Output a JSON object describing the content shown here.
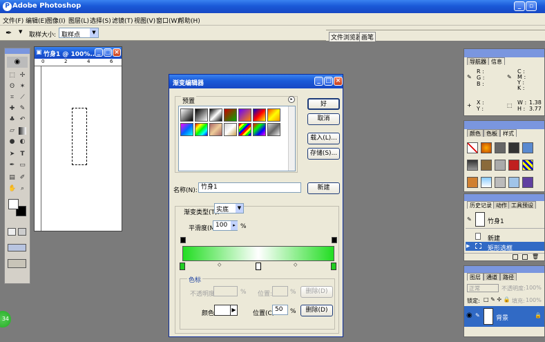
{
  "app": {
    "title": "Adobe Photoshop",
    "icon": "photoshop-icon"
  },
  "menu": [
    "文件(F)",
    "编辑(E)",
    "图像(I)",
    "图层(L)",
    "选择(S)",
    "滤镜(T)",
    "视图(V)",
    "窗口(W)",
    "帮助(H)"
  ],
  "options": {
    "sample_label": "取样大小:",
    "sample_value": "取样点",
    "tabs": [
      "文件浏览器",
      "画笔"
    ]
  },
  "doc": {
    "title": "竹身1 @ 100%...",
    "ruler": [
      "0",
      "2",
      "4",
      "6"
    ]
  },
  "dialog": {
    "title": "渐变编辑器",
    "presets_label": "预置",
    "ok": "好",
    "cancel": "取消",
    "load": "载入(L)...",
    "save": "存储(S)...",
    "name_label": "名称(N):",
    "name_value": "竹身1",
    "new_btn": "新建",
    "type_label": "渐变类型(T):",
    "type_value": "实底",
    "smooth_label": "平滑度(M):",
    "smooth_value": "100",
    "smooth_unit": "%",
    "stops": {
      "title": "色标",
      "opacity_label": "不透明度:",
      "opacity_unit": "%",
      "loc_label": "位置:",
      "loc_unit": "%",
      "delete_label": "删除(D)",
      "color_label": "颜色:",
      "color_loc_label": "位置(C):",
      "color_loc_value": "50",
      "color_loc_unit": "%",
      "color_delete": "删除(D)"
    },
    "gradient": {
      "left": "#22dd22",
      "mid": "#ffffff",
      "right": "#22dd22",
      "midpoint": 50
    }
  },
  "navigator": {
    "tabs": [
      "导航器",
      "信息"
    ],
    "rgb": [
      "R :",
      "G :",
      "B :"
    ],
    "cmyk": [
      "C :",
      "M :",
      "Y :",
      "K :"
    ],
    "xy": [
      "X :",
      "Y :"
    ],
    "wh": [
      "W :",
      "H :"
    ],
    "w_value": "1.38",
    "h_value": "3.77"
  },
  "swatches": {
    "tabs": [
      "颜色",
      "色板",
      "样式"
    ]
  },
  "history": {
    "tabs": [
      "历史记录",
      "动作",
      "工具预设"
    ],
    "snapshot": "竹身1",
    "items": [
      "新建",
      "矩形选框"
    ]
  },
  "layers": {
    "tabs": [
      "图层",
      "通道",
      "路径"
    ],
    "blend": "正常",
    "opacity_label": "不透明度:",
    "opacity_value": "100%",
    "lock_label": "锁定:",
    "fill_label": "填充:",
    "fill_value": "100%",
    "layer_name": "背景"
  },
  "taskbar": {
    "badge": "34"
  }
}
